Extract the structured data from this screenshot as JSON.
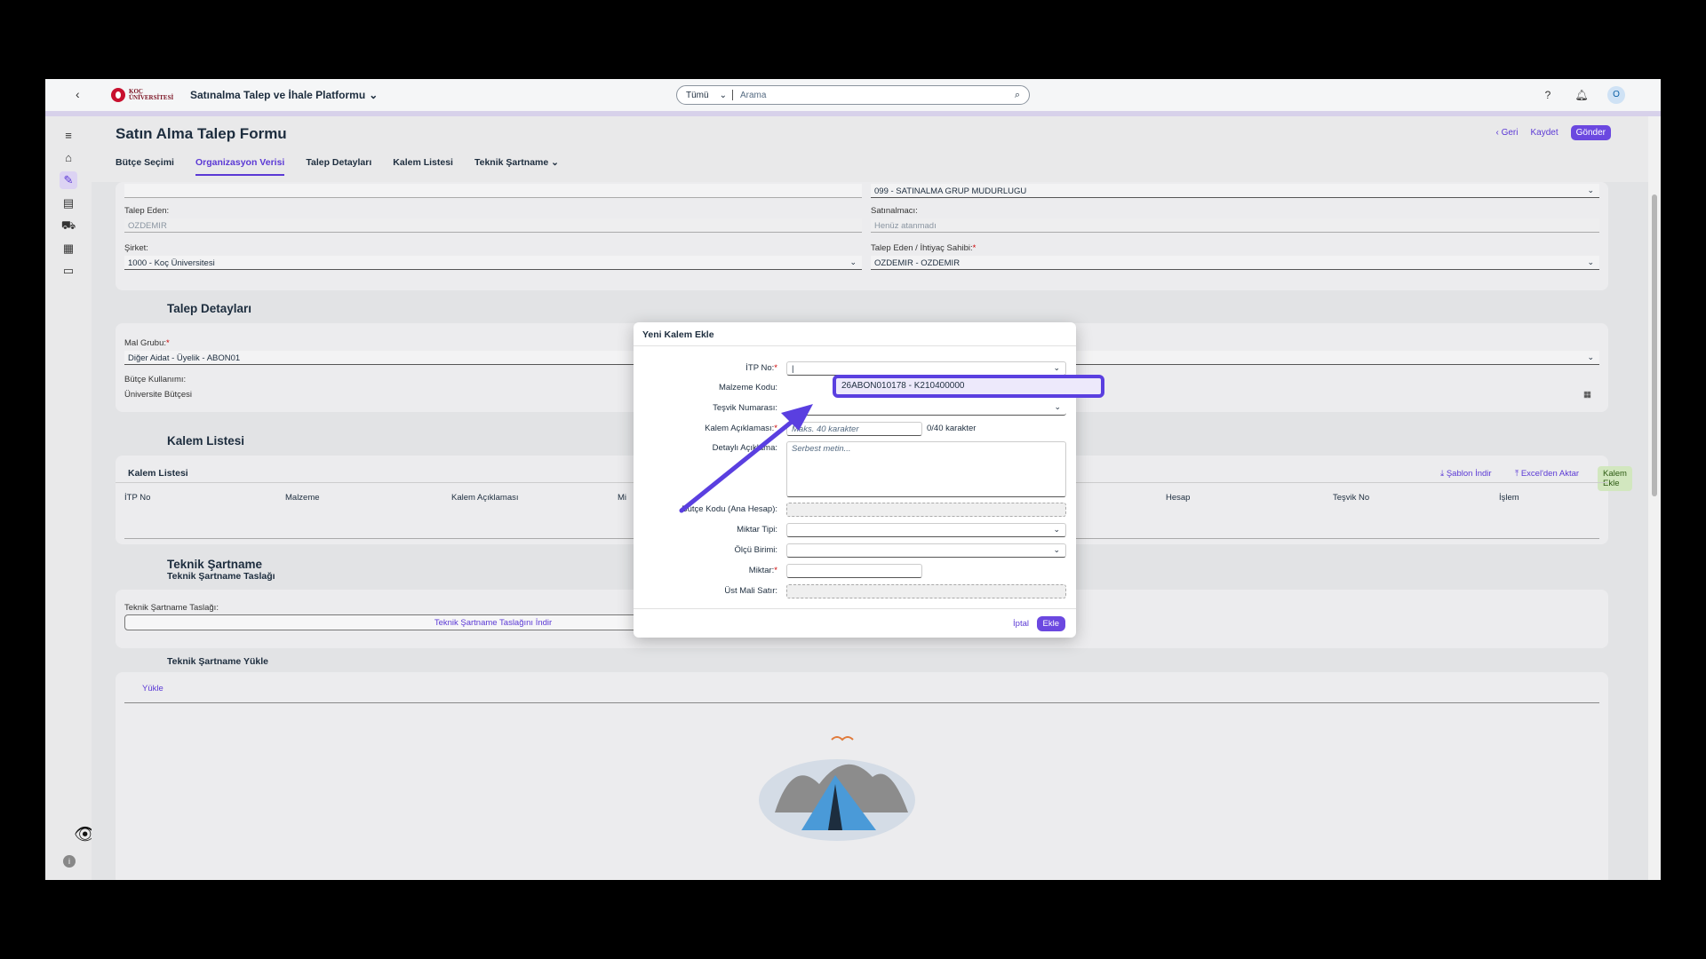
{
  "shell": {
    "logo_text_line1": "KOÇ",
    "logo_text_line2": "ÜNİVERSİTESİ",
    "app_title": "Satınalma Talep ve İhale Platformu",
    "search_scope": "Tümü",
    "search_placeholder": "Arama",
    "avatar_initial": "O"
  },
  "page": {
    "title": "Satın Alma Talep Formu",
    "actions": {
      "back": "Geri",
      "save": "Kaydet",
      "send": "Gönder"
    },
    "tabs": [
      "Bütçe Seçimi",
      "Organizasyon Verisi",
      "Talep Detayları",
      "Kalem Listesi",
      "Teknik Şartname"
    ],
    "active_tab": "Organizasyon Verisi"
  },
  "org": {
    "purchasing_group_value": "099 - SATINALMA GRUP MUDURLUGU",
    "requester_label": "Talep Eden:",
    "requester_value": "OZDEMIR",
    "buyer_label": "Satınalmacı:",
    "buyer_placeholder": "Henüz atanmadı",
    "company_label": "Şirket:",
    "company_value": "1000 - Koç Üniversitesi",
    "owner_label": "Talep Eden / İhtiyaç Sahibi:",
    "owner_value": "OZDEMIR - OZDEMIR"
  },
  "details": {
    "title": "Talep Detayları",
    "material_group_label": "Mal Grubu:",
    "material_group_value": "Diğer Aidat - Üyelik - ABON01",
    "budget_usage_label": "Bütçe Kullanımı:",
    "budget_usage_value": "Üniversite Bütçesi"
  },
  "items": {
    "section_title": "Kalem Listesi",
    "card_title": "Kalem Listesi",
    "template_download": "Şablon İndir",
    "excel_import": "Excel'den Aktar",
    "add_item": "Kalem Ekle",
    "columns": [
      "İTP No",
      "Malzeme",
      "Kalem Açıklaması",
      "Mi",
      "Hesap",
      "Teşvik No",
      "İşlem"
    ]
  },
  "tech": {
    "title": "Teknik Şartname",
    "subtitle": "Teknik Şartname Taslağı",
    "draft_label": "Teknik Şartname Taslağı:",
    "draft_download": "Teknik Şartname Taslağını İndir",
    "upload_title": "Teknik Şartname Yükle",
    "upload_button": "Yükle"
  },
  "dialog": {
    "title": "Yeni Kalem Ekle",
    "fields": {
      "itp_no": "İTP No:",
      "material_code": "Malzeme Kodu:",
      "incentive_no": "Teşvik Numarası:",
      "item_desc": "Kalem Açıklaması:",
      "item_desc_placeholder": "Maks. 40 karakter",
      "item_desc_counter": "0/40 karakter",
      "detail_desc": "Detaylı Açıklama:",
      "detail_desc_placeholder": "Serbest metin...",
      "budget_code": "Bütçe Kodu (Ana Hesap):",
      "qty_type": "Miktar Tipi:",
      "unit": "Ölçü Birimi:",
      "qty": "Miktar:",
      "parent_row": "Üst Mali Satır:"
    },
    "material_code_value": "26ABON010178 - K210400000",
    "cancel": "İptal",
    "add": "Ekle"
  },
  "colors": {
    "accent": "#6b48e0",
    "highlight": "#5a3fe0"
  }
}
